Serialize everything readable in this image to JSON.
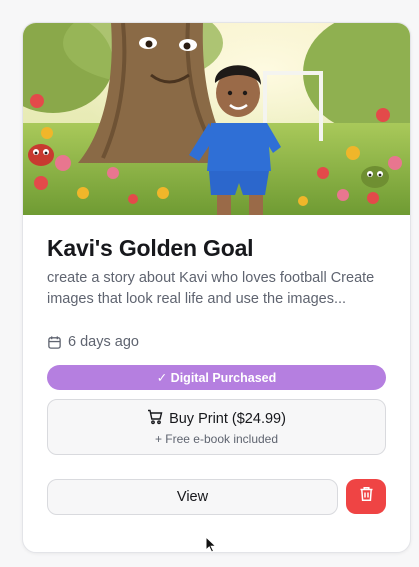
{
  "card": {
    "title": "Kavi's Golden Goal",
    "description": "create a story about Kavi who loves football Create images that look real life and use the images...",
    "date": "6 days ago",
    "status_badge": "✓ Digital Purchased",
    "print_button": {
      "label": "Buy Print ($24.99)",
      "sublabel": "+ Free e-book included"
    },
    "view_button": "View"
  },
  "colors": {
    "badge": "#b57fe0",
    "delete": "#ef4444",
    "title": "#17181c",
    "muted": "#5f6470"
  },
  "icons": [
    "calendar-icon",
    "check-icon",
    "cart-icon",
    "trash-icon",
    "mouse-cursor-icon"
  ]
}
